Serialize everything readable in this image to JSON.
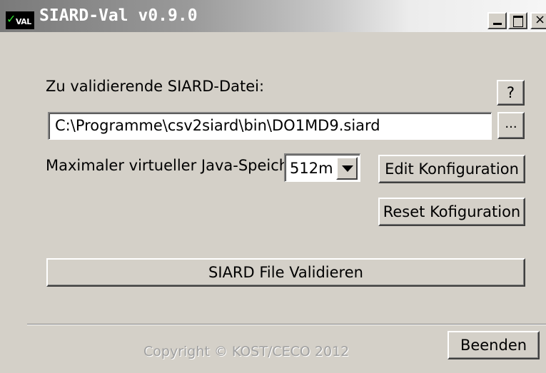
{
  "window": {
    "title": "SIARD-Val v0.9.0",
    "icon_label": "VAL",
    "minimize_icon": "minimize-icon",
    "maximize_icon": "maximize-icon",
    "close_icon": "close-icon",
    "close_glyph": "×"
  },
  "form": {
    "file_label": "Zu validierende SIARD-Datei:",
    "help_button": "?",
    "file_path": "C:\\Programme\\csv2siard\\bin\\DO1MD9.siard",
    "browse_button": "...",
    "memory_label": "Maximaler virtueller Java-Speicher:",
    "memory_value": "512m",
    "edit_config_button": "Edit Konfiguration",
    "reset_config_button": "Reset Kofiguration",
    "validate_button": "SIARD File Validieren"
  },
  "footer": {
    "copyright": "Copyright © KOST/CECO 2012",
    "exit_button": "Beenden"
  },
  "colors": {
    "face": "#d4d0c8",
    "title_text": "#ffffff",
    "copyright_text": "#a0a0a0"
  }
}
